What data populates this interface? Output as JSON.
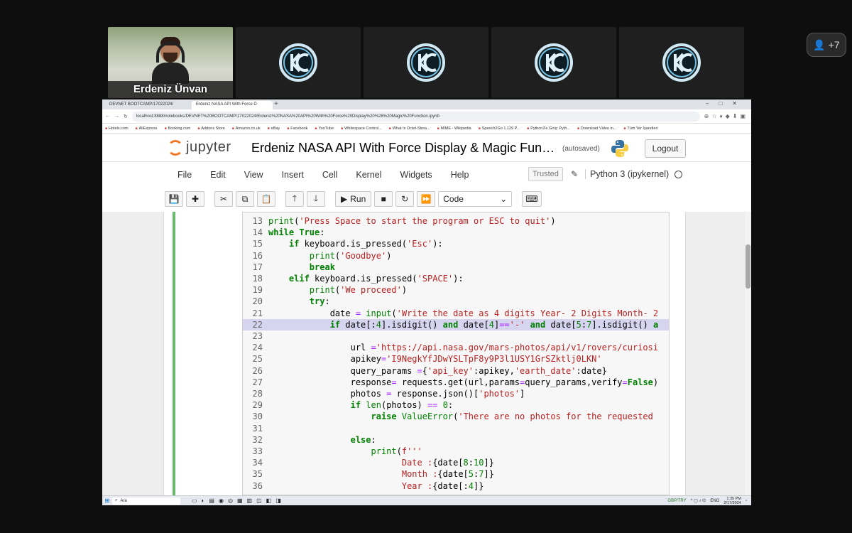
{
  "meeting": {
    "participant_name": "Erdeniz Ünvan",
    "peer_count": "+7"
  },
  "browser": {
    "tabs": [
      "DEVNET BOOTCAMP/17022024/",
      "Erdeniz NASA API With Force D"
    ],
    "url": "localhost:8888/notebooks/DEVNET%20BOOTCAMP/17022024/Erdeniz%20NASA%20API%20With%20Force%20Display%20%26%20Magic%20Function.ipynb",
    "bookmarks": [
      "Hotels.com",
      "AliExpress",
      "Booking.com",
      "Addons Store",
      "Amazon.co.uk",
      "eBay",
      "Facebook",
      "YouTube",
      "Whitespace Control...",
      "What Is Octet-Strea...",
      "MIME - Wikipedia",
      "Speech2Go 1.129 P...",
      "Python3'e Giriş: Pyth...",
      "Download Video in...",
      "Tüm Yer İşaretleri"
    ]
  },
  "jupyter": {
    "logo_text": "jupyter",
    "title": "Erdeniz NASA API With Force Display & Magic Fun…",
    "autosave": "(autosaved)",
    "logout_label": "Logout",
    "menu": [
      "File",
      "Edit",
      "View",
      "Insert",
      "Cell",
      "Kernel",
      "Widgets",
      "Help"
    ],
    "trusted": "Trusted",
    "kernel_name": "Python 3 (ipykernel)",
    "run_label": "Run",
    "cell_type": "Code"
  },
  "code_lines": [
    {
      "n": "13",
      "html": "<span class=\"fn\">print</span>(<span class=\"st\">'Press Space to start the program or ESC to quit'</span>)"
    },
    {
      "n": "14",
      "html": "<span class=\"kw\">while</span> <span class=\"kw\">True</span>:"
    },
    {
      "n": "15",
      "html": "    <span class=\"kw\">if</span> keyboard.is_pressed(<span class=\"st\">'Esc'</span>):"
    },
    {
      "n": "16",
      "html": "        <span class=\"fn\">print</span>(<span class=\"st\">'Goodbye'</span>)"
    },
    {
      "n": "17",
      "html": "        <span class=\"kw\">break</span>"
    },
    {
      "n": "18",
      "html": "    <span class=\"kw\">elif</span> keyboard.is_pressed(<span class=\"st\">'SPACE'</span>):"
    },
    {
      "n": "19",
      "html": "        <span class=\"fn\">print</span>(<span class=\"st\">'We proceed'</span>)"
    },
    {
      "n": "20",
      "html": "        <span class=\"kw\">try</span>:"
    },
    {
      "n": "21",
      "html": "            date <span class=\"op\">=</span> <span class=\"fn\">input</span>(<span class=\"st\">'Write the date as 4 digits Year- 2 Digits Month- 2</span>"
    },
    {
      "n": "22",
      "html": "            <span class=\"kw\">if</span> date[:<span class=\"nm\">4</span>].isdigit() <span class=\"kw\">and</span> date[<span class=\"nm\">4</span>]<span class=\"op\">==</span><span class=\"st\">'-'</span> <span class=\"kw\">and</span> date[<span class=\"nm\">5</span>:<span class=\"nm\">7</span>].isdigit() <span class=\"kw\">a</span>",
      "hl": true
    },
    {
      "n": "23",
      "html": ""
    },
    {
      "n": "24",
      "html": "                url <span class=\"op\">=</span><span class=\"st\">'https://api.nasa.gov/mars-photos/api/v1/rovers/curiosi</span>"
    },
    {
      "n": "25",
      "html": "                apikey<span class=\"op\">=</span><span class=\"st\">'I9NegkYfJDwYSLTpF8y9P3l1USY1GrSZktlj0LKN'</span>"
    },
    {
      "n": "26",
      "html": "                query_params <span class=\"op\">=</span>{<span class=\"st\">'api_key'</span>:apikey,<span class=\"st\">'earth_date'</span>:date}"
    },
    {
      "n": "27",
      "html": "                response<span class=\"op\">=</span> requests.get(url,params<span class=\"op\">=</span>query_params,verify<span class=\"op\">=</span><span class=\"kw\">False</span>)"
    },
    {
      "n": "28",
      "html": "                photos <span class=\"op\">=</span> response.json()[<span class=\"st\">'photos'</span>]"
    },
    {
      "n": "29",
      "html": "                <span class=\"kw\">if</span> <span class=\"fn\">len</span>(photos) <span class=\"op\">==</span> <span class=\"nm\">0</span>:"
    },
    {
      "n": "30",
      "html": "                    <span class=\"kw\">raise</span> <span class=\"fn\">ValueError</span>(<span class=\"st\">'There are no photos for the requested</span>"
    },
    {
      "n": "31",
      "html": ""
    },
    {
      "n": "32",
      "html": "                <span class=\"kw\">else</span>:"
    },
    {
      "n": "33",
      "html": "                    <span class=\"fn\">print</span>(<span class=\"st\">f'''</span>"
    },
    {
      "n": "34",
      "html": "<span class=\"st\">                          Date :</span>{date[<span class=\"nm\">8</span>:<span class=\"nm\">10</span>]}"
    },
    {
      "n": "35",
      "html": "<span class=\"st\">                          Month :</span>{date[<span class=\"nm\">5</span>:<span class=\"nm\">7</span>]}"
    },
    {
      "n": "36",
      "html": "<span class=\"st\">                          Year :</span>{date[:<span class=\"nm\">4</span>]}"
    }
  ],
  "taskbar": {
    "search_text": "Ara",
    "ticker": "GBP/TRY",
    "lang": "ENG",
    "time": "1:35 PM",
    "date": "2/17/2024"
  },
  "colors": {
    "cell_selected_bar": "#66bb6a",
    "highlight_line": "#d7d4f0",
    "jupyter_orange": "#f37726"
  }
}
